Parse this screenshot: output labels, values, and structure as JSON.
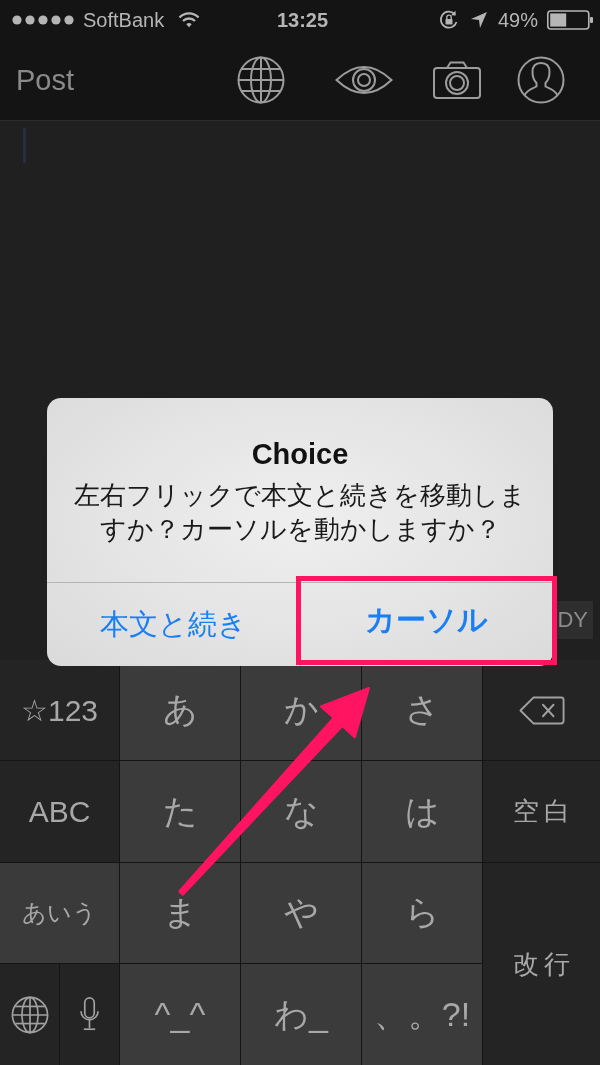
{
  "status_bar": {
    "carrier": "SoftBank",
    "time": "13:25",
    "battery_percent": "49%"
  },
  "nav_bar": {
    "title": "Post"
  },
  "editor": {
    "toolbar_label": "DY"
  },
  "dialog": {
    "title": "Choice",
    "message": "左右フリックで本文と続きを移動しますか？カーソルを動かしますか？",
    "buttons": [
      {
        "label": "本文と続き",
        "kind": "cancel",
        "highlighted": false
      },
      {
        "label": "カーソル",
        "kind": "preferred",
        "highlighted": true
      }
    ]
  },
  "keyboard": {
    "mode_keys": [
      {
        "label": "☆123",
        "selected": false
      },
      {
        "label": "ABC",
        "selected": false
      },
      {
        "label": "あいう",
        "selected": true
      }
    ],
    "kana_keys": [
      "あ",
      "か",
      "さ",
      "た",
      "な",
      "は",
      "ま",
      "や",
      "ら",
      "^_^",
      "わ_",
      "、。?!"
    ],
    "space_key": "空白",
    "return_key": "改行"
  }
}
